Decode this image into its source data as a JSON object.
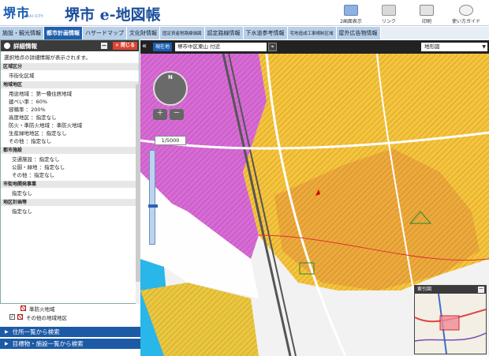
{
  "header": {
    "logo_text": "堺市",
    "logo_sub": "SAKAI CITY",
    "site_title": "堺市 e-地図帳",
    "buttons": [
      {
        "label": "2画面表示",
        "icon": "dual-screen-icon"
      },
      {
        "label": "リンク",
        "icon": "link-icon"
      },
      {
        "label": "印刷",
        "icon": "print-icon"
      },
      {
        "label": "使い方ガイド",
        "icon": "guide-icon"
      }
    ]
  },
  "tabs": [
    {
      "label": "施設・観光情報"
    },
    {
      "label": "都市計画情報"
    },
    {
      "label": "ハザードマップ"
    },
    {
      "label": "文化財情報"
    },
    {
      "label": "固定資産税路線価図"
    },
    {
      "label": "認定路線情報"
    },
    {
      "label": "下水道参考情報"
    },
    {
      "label": "宅地造成工事規制区域"
    },
    {
      "label": "屋外広告物情報"
    }
  ],
  "panel": {
    "title": "詳細情報",
    "minimize": "－",
    "close_label": "✕ 閉じる",
    "intro": "選択地点の詳細情報が表示されます。",
    "sections": [
      {
        "header": "区域区分",
        "items": [
          "市街化区域"
        ]
      },
      {
        "header": "地域地区",
        "items": [
          "用途地域 ：第一種住居地域",
          "建ぺい率 ：60%",
          "容積率 ：200%",
          "高度地区 ：指定なし",
          "防火・準防火地域 ：準防火地域",
          "生産緑地地区 ：指定なし",
          "その他 ：指定なし"
        ]
      },
      {
        "header": "都市施設",
        "items": [
          "交通施設 ：指定なし",
          "公園・緑地 ：指定なし",
          "その他 ：指定なし"
        ]
      },
      {
        "header": "市街地開発事業",
        "items": [
          "指定なし"
        ]
      },
      {
        "header": "地区計画等",
        "items": [
          "指定なし"
        ]
      }
    ]
  },
  "legend": {
    "row1": "準防火地域",
    "row2": "その他の地域地区"
  },
  "search": {
    "by_address": "住所一覧から検索",
    "by_landmark": "目標物・施設一覧から検索"
  },
  "map": {
    "location_label": "現在地",
    "location_value": "堺市中区東山 付近",
    "map_type": "地形図",
    "compass_n": "N",
    "zoom_in": "＋",
    "zoom_out": "－",
    "scale": "1/5000",
    "index_title": "索引図",
    "index_min": "－"
  },
  "colors": {
    "accent": "#1f5fae",
    "zone_yellow": "#f3c63a",
    "zone_magenta": "#d86ad6",
    "zone_cyan": "#29b6e8",
    "zone_orange": "#e9a63a"
  }
}
